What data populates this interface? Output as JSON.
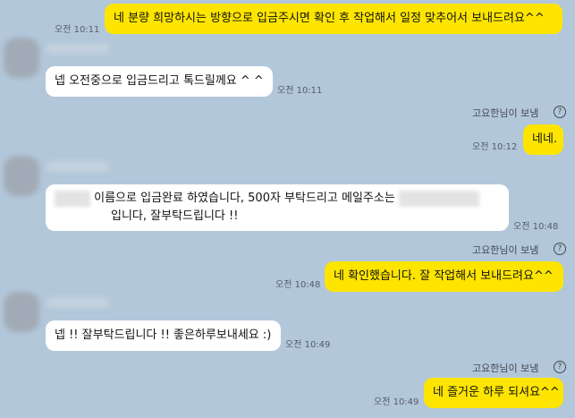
{
  "messages": {
    "m1": {
      "text": "네 분량 희망하시는 방향으로 입금주시면 확인 후 작업해서 일정 맞추어서 보내드려요^^",
      "time": "오전 10:11"
    },
    "m2": {
      "text": "넵 오전중으로 입금드리고 톡드릴께요 ^ ^",
      "time": "오전 10:11"
    },
    "m3": {
      "text": "네네.",
      "time": "오전 10:12",
      "seen": "고요한님이 보냄"
    },
    "m4": {
      "line1": "이름으로 입금완료 하였습니다, 500자 부탁드리고 메일주소는",
      "line2": "입니다, 잘부탁드립니다 !!",
      "time": "오전 10:48"
    },
    "m5": {
      "text": "네 확인했습니다. 잘 작업해서 보내드려요^^",
      "time": "오전 10:48",
      "seen": "고요한님이 보냄"
    },
    "m6": {
      "text": "넵 !! 잘부탁드립니다 !! 좋은하루보내세요 :)",
      "time": "오전 10:49"
    },
    "m7": {
      "text": "네 즐거운 하루 되셔요^^",
      "time": "오전 10:49",
      "seen": "고요한님이 보냄"
    }
  },
  "icons": {
    "info": "question-circle-icon"
  },
  "icon_glyph": "?",
  "colors": {
    "background": "#b2c7da",
    "my_bubble": "#fee500",
    "other_bubble": "#ffffff"
  }
}
